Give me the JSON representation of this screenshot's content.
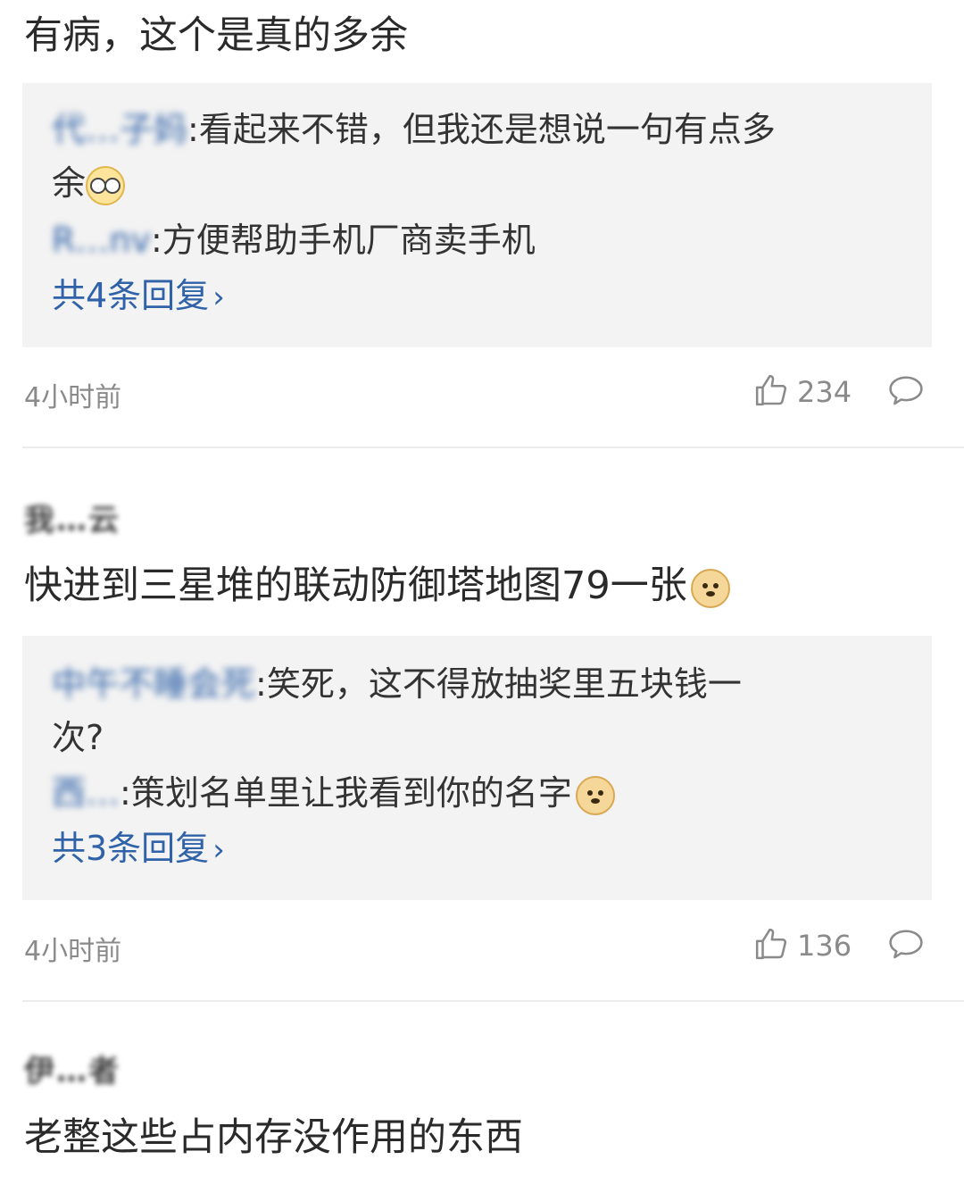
{
  "comments": [
    {
      "username": "",
      "text": "有病，这个是真的多余",
      "replies": [
        {
          "user": "代…子妈",
          "text_line1": "看起来不错，但我还是想说一句有点多",
          "text_line2": "余",
          "emoji": "glasses-emoji"
        },
        {
          "user": "R…nv",
          "text_line1": "方便帮助手机厂商卖手机"
        }
      ],
      "more_replies": "共4条回复",
      "time": "4小时前",
      "likes": "234"
    },
    {
      "username": "我…云",
      "text": "快进到三星堆的联动防御塔地图79一张",
      "emoji": "doge-emoji",
      "replies": [
        {
          "user": "中午不睡会死",
          "text_line1": "笑死，这不得放抽奖里五块钱一",
          "text_line2": "次?"
        },
        {
          "user": "西…",
          "text_line1": "策划名单里让我看到你的名字",
          "emoji": "doge-emoji"
        }
      ],
      "more_replies": "共3条回复",
      "time": "4小时前",
      "likes": "136"
    },
    {
      "username": "伊…者",
      "text": "老整这些占内存没作用的东西"
    }
  ],
  "icons": {
    "like": "thumbs-up-icon",
    "comment": "comment-bubble-icon",
    "chevron": "chevron-right-icon"
  },
  "colors": {
    "link": "#2f62a8",
    "reply_bg": "#f3f3f3",
    "meta": "#8a8a8a"
  }
}
